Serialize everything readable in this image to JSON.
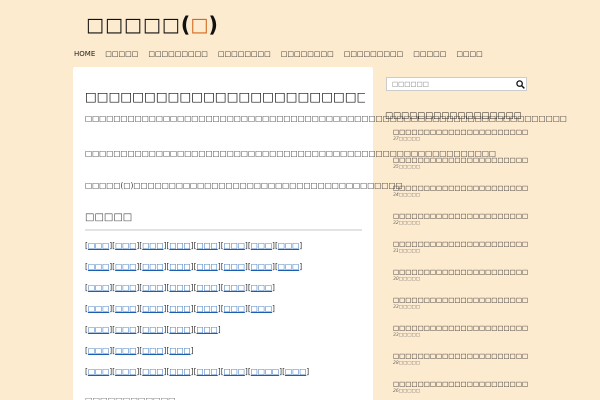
{
  "header": {
    "logo_main": "□□□□□",
    "logo_open": "(",
    "logo_accent": "□",
    "logo_close": ")"
  },
  "nav": {
    "items": [
      "HOME",
      "□□□□□",
      "□□□□□□□□□",
      "□□□□□□□□",
      "□□□□□□□□",
      "□□□□□□□□□",
      "□□□□□",
      "□□□□"
    ]
  },
  "post": {
    "title": "□□□□□□□□□□□□□□□□□□□□□□□□□□□□□□□□",
    "p1": "□□□□□□□□□□□□□□□□□□□□□□□□□□□□□□□□□□□□□□□□□□□□□□□□□□□□□□□□□□□□□□□□□□□□",
    "p2": "□□□□□□□□□□□□□□□□□□□□□□□□□□□□□□□□□□□□□□□□□□□□□□□□□□□□□□□□□□",
    "p3": "□□□□□(□)□□□□□□□□□□□□□□□□□□□□□□□□□□□□□□□□□□□□□□",
    "section_title": "□□□□□",
    "link_rows": [
      [
        "□□□",
        "□□□",
        "□□□",
        "□□□",
        "□□□",
        "□□□",
        "□□□",
        "□□□"
      ],
      [
        "□□□",
        "□□□",
        "□□□",
        "□□□",
        "□□□",
        "□□□",
        "□□□",
        "□□□"
      ],
      [
        "□□□",
        "□□□",
        "□□□",
        "□□□",
        "□□□",
        "□□□",
        "□□□"
      ],
      [
        "□□□",
        "□□□",
        "□□□",
        "□□□",
        "□□□",
        "□□□",
        "□□□"
      ],
      [
        "□□□",
        "□□□",
        "□□□",
        "□□□",
        "□□□"
      ],
      [
        "□□□",
        "□□□",
        "□□□",
        "□□□"
      ],
      [
        "□□□",
        "□□□",
        "□□□",
        "□□□",
        "□□□",
        "□□□",
        "□□□□",
        "□□□"
      ]
    ],
    "sub_section_title": "□□□□□□□□□□□□"
  },
  "sidebar": {
    "search_placeholder": "□□□□□□",
    "heading": "□□□□□□□□□□□□□□□□□",
    "items": [
      {
        "title": "□□□□□□□□□□□□□□□□□□□□□□□□□□□□□□□□□□□",
        "date": "37□□□□□"
      },
      {
        "title": "□□□□□□□□□□□□□□□□□□□□□□□□□□□□□□□□□□",
        "date": "35□□□□□"
      },
      {
        "title": "□□□□□□□□□□□□□□□□□□□□□□□□□□□□□□□□□□",
        "date": "34□□□□□"
      },
      {
        "title": "□□□□□□□□□□□□□□□□□□□□□□□□□□□□□□□□",
        "date": "32□□□□□"
      },
      {
        "title": "□□□□□□□□□□□□□□□□□□□□□□□□□□□□□□□□□",
        "date": "31□□□□□"
      },
      {
        "title": "□□□□□□□□□□□□□□□□□□□□□□□□□□□□□□□□□□",
        "date": "30□□□□□"
      },
      {
        "title": "□□□□□□□□□□□□□□□□□□□□□□□□□□□□□□□□□□",
        "date": "33□□□□□"
      },
      {
        "title": "□□□□□□□□□□□□□□□□□□□□□□□□□□□□□□□□□",
        "date": "33□□□□□"
      },
      {
        "title": "□□□□□□□□□□□□□□□□□□□□□□□□□□□□□□□□",
        "date": "28□□□□□"
      },
      {
        "title": "□□□□□□□□□□□□□□□□□□□□□□□□□□□□□□□",
        "date": "26□□□□□"
      }
    ]
  },
  "colors": {
    "background": "#fdebd0",
    "link": "#1a5fb4",
    "logo_accent": "#d2691e"
  }
}
